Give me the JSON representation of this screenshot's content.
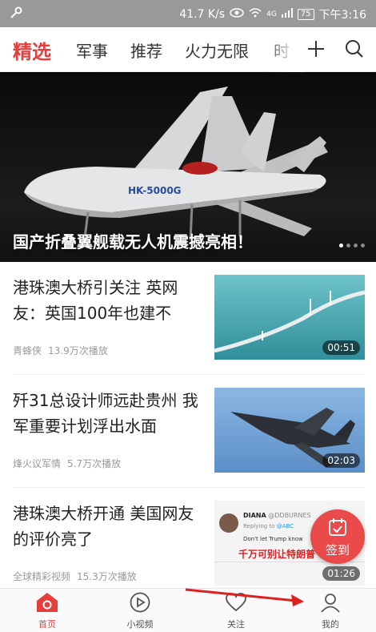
{
  "status_bar": {
    "speed": "41.7 K/s",
    "signal": "4G",
    "battery": "75",
    "time": "下午3:16"
  },
  "tabs": [
    {
      "label": "精选",
      "active": true
    },
    {
      "label": "军事"
    },
    {
      "label": "推荐"
    },
    {
      "label": "火力无限"
    },
    {
      "label": "时"
    }
  ],
  "nav_icons": [
    "plus-icon",
    "search-icon"
  ],
  "banner": {
    "title": "国产折叠翼舰载无人机震撼亮相！",
    "aircraft_marking": "HK-5000G",
    "page_count": 4,
    "active_index": 0
  },
  "feed": [
    {
      "title": "港珠澳大桥引关注 英网友：英国100年也建不",
      "source": "青蜂侠",
      "plays": "13.9万次播放",
      "duration": "00:51"
    },
    {
      "title": "歼31总设计师远赴贵州 我军重要计划浮出水面",
      "source": "烽火议军情",
      "plays": "5.7万次播放",
      "duration": "02:03"
    },
    {
      "title": "港珠澳大桥开通 美国网友的评价亮了",
      "source": "全球精彩视频",
      "plays": "15.3万次播放",
      "duration": "01:26"
    }
  ],
  "tweet_thumb": {
    "name": "DIANA",
    "handle": "@DDBURNES",
    "reply_to": "Replying to",
    "reply_handle": "@ABC",
    "text": "Don't let Trump know",
    "caption": "千万可别让特朗普"
  },
  "signin_button": {
    "label": "签到"
  },
  "bottom_nav": [
    {
      "label": "首页",
      "icon": "home-icon",
      "active": true
    },
    {
      "label": "小视频",
      "icon": "play-icon"
    },
    {
      "label": "关注",
      "icon": "heart-icon"
    },
    {
      "label": "我的",
      "icon": "profile-icon"
    }
  ],
  "colors": {
    "accent": "#e63d3d",
    "status_bar": "#999999"
  }
}
